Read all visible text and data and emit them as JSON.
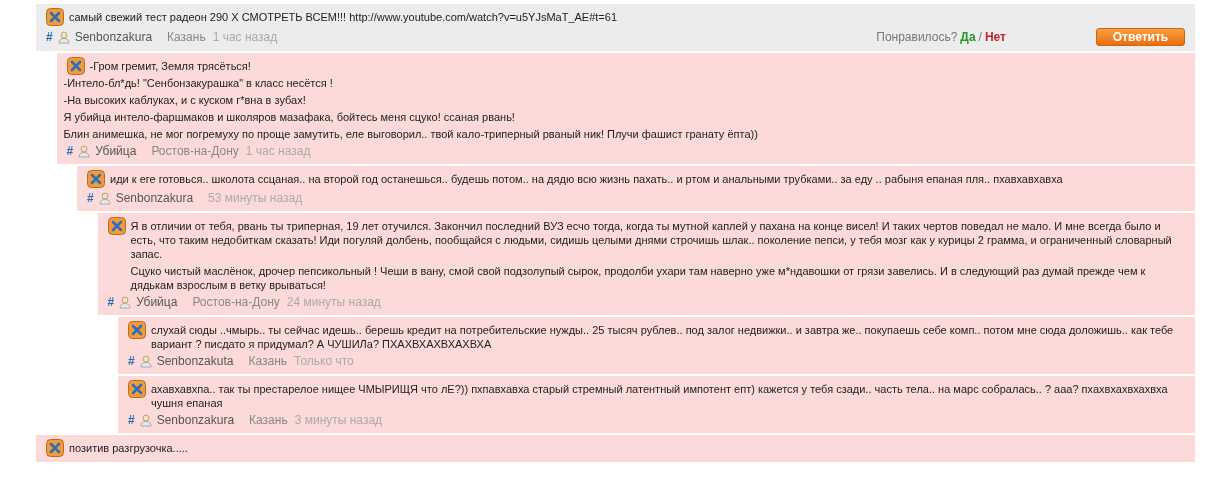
{
  "threads": [
    {
      "highlighted": true,
      "paragraphs": [
        "самый свежий тест радеон 290 Х СМОТРЕТЬ ВСЕМ!!! http://www.youtube.com/watch?v=u5YJsMaT_AE#t=61"
      ],
      "meta": {
        "hash": "#",
        "author": "Senbonzakura",
        "city": "Казань",
        "time": "1 час назад"
      },
      "vote": {
        "label": "Понравилось?",
        "yes": "Да",
        "separator": "/",
        "no": "Нет"
      },
      "reply_button": "Ответить",
      "children": [
        {
          "paragraphs": [
            "-Гром гремит, Земля трясёться!",
            "-Интело-бл*дь! \"Сенбонзакурашка\" в класс несётся !",
            "-На высоких каблуках, и с куском г*вна в зубах!",
            "Я убийца интело-фаршмаков и школяров мазафака, бойтесь меня сцуко! ссаная рвань!",
            "Блин анимешка, не мог погремуху по проще замутить, еле выговорил.. твой кало-триперный рваный ник! Плучи фашист гранату ёпта))"
          ],
          "meta": {
            "hash": "#",
            "author": "Убийца",
            "city": "Ростов-на-Дону",
            "time": "1 час назад"
          },
          "children": [
            {
              "paragraphs": [
                "иди к еге готовься.. школота ссцаная.. на второй год останешься.. будешь потом.. на дядю всю жизнь пахать.. и ртом и анальными трубками.. за еду .. рабыня епаная пля.. пхавхавхавха"
              ],
              "meta": {
                "hash": "#",
                "author": "Senbonzakura",
                "time": "53 минуты назад"
              },
              "children": [
                {
                  "paragraphs": [
                    "Я в отличии от тебя, рвань ты триперная, 19 лет отучился. Закончил последний ВУЗ есчо тогда, когда ты мутной каплей у пахана на конце висел! И таких чертов поведал не мало. И мне всегда было и есть, что таким недобиткам сказать! Иди погуляй долбень, пообщайся с людьми, сидишь целыми днями строчишь шлак.. поколение пепси, у тебя мозг как у курицы 2 грамма, и ограниченный словарный запас.",
                    "Сцуко чистый маслёнок, дрочер пепсикольный ! Чеши в вану, смой свой подзолупый сырок, продолби ухари там наверно уже м*ндавошки от грязи завелись. И в следующий раз думай прежде чем к дядькам взрослым в ветку врываться!"
                  ],
                  "meta": {
                    "hash": "#",
                    "author": "Убийца",
                    "city": "Ростов-на-Дону",
                    "time": "24 минуты назад"
                  },
                  "children": [
                    {
                      "paragraphs": [
                        "слухай сюды ..чмырь.. ты сейчас идешь.. берешь кредит на потребительские нужды.. 25 тысяч рублев.. под залог недвижки.. и завтра же.. покупаешь себе комп.. потом мне сюда доложишь.. как тебе вариант ? писдато я придумал? А ЧУШИЛа? ПХАХВХАХВХАХВХА"
                      ],
                      "meta": {
                        "hash": "#",
                        "author": "Senbonzakuta",
                        "city": "Казань",
                        "time": "Только что"
                      }
                    },
                    {
                      "paragraphs": [
                        "ахавхавхпа.. так ты престарелое нищее ЧМЫРИЩЯ что лЕ?)) пхпавхавха старый стремный латентный импотент епт) кажется у тебя сзади.. часть тела.. на марс собралась.. ? ааа? пхахвхахвхахвха чушня епаная"
                      ],
                      "meta": {
                        "hash": "#",
                        "author": "Senbonzakura",
                        "city": "Казань",
                        "time": "3 минуты назад"
                      }
                    }
                  ]
                }
              ]
            }
          ]
        }
      ]
    },
    {
      "highlighted": false,
      "paragraphs": [
        "позитив разгрузочка....."
      ]
    }
  ]
}
